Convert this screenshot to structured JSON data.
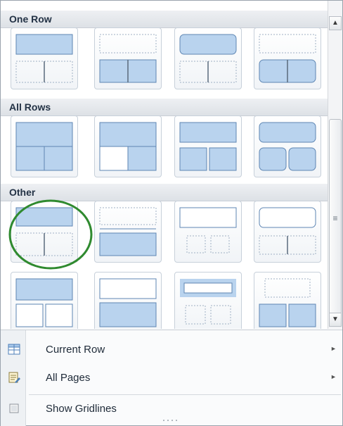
{
  "sections": [
    {
      "title": "One Row"
    },
    {
      "title": "All Rows"
    },
    {
      "title": "Other"
    }
  ],
  "tiles": [
    {
      "name": "one-row-layout-1"
    },
    {
      "name": "one-row-layout-2"
    },
    {
      "name": "one-row-layout-3"
    },
    {
      "name": "one-row-layout-4"
    },
    {
      "name": "all-rows-layout-1"
    },
    {
      "name": "all-rows-layout-2"
    },
    {
      "name": "all-rows-layout-3"
    },
    {
      "name": "all-rows-layout-4"
    },
    {
      "name": "other-layout-1",
      "highlighted": true
    },
    {
      "name": "other-layout-2"
    },
    {
      "name": "other-layout-3"
    },
    {
      "name": "other-layout-4"
    },
    {
      "name": "other-layout-5"
    },
    {
      "name": "other-layout-6"
    },
    {
      "name": "other-layout-7"
    },
    {
      "name": "other-layout-8"
    }
  ],
  "menu": {
    "current_row": {
      "label": "Current Row",
      "icon": "table-grid-icon",
      "has_submenu": true
    },
    "all_pages": {
      "label": "All Pages",
      "icon": "pages-edit-icon",
      "has_submenu": true
    },
    "show_gridlines": {
      "label": "Show Gridlines",
      "icon": "checkbox-icon",
      "checked": false
    }
  },
  "colors": {
    "fill": "#b9d3ee",
    "stroke": "#5e86b3",
    "dotted": "#9fb0c4",
    "highlight_circle": "#2f8a2f"
  }
}
